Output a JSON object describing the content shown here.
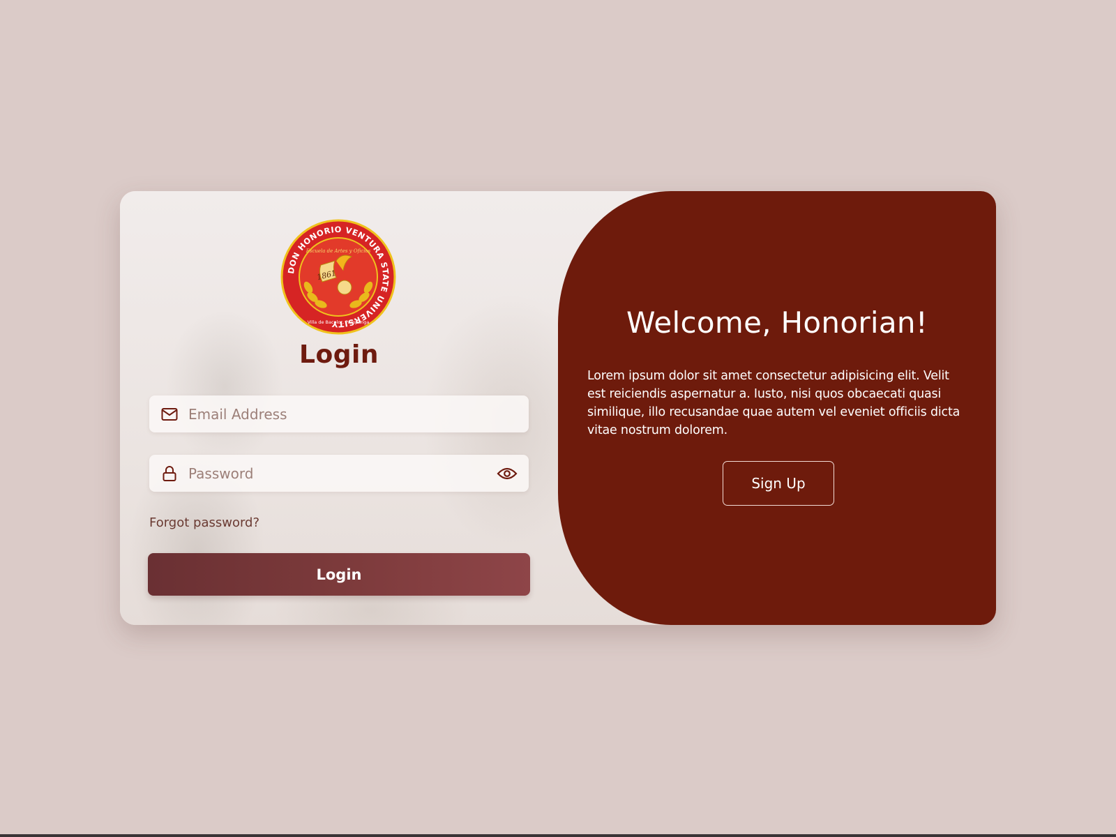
{
  "colors": {
    "background": "#dbcbc8",
    "brand_maroon": "#6e1b0c",
    "login_button": "#7c3a3b",
    "seal_red": "#d62424",
    "seal_gold": "#f0c21d"
  },
  "logo": {
    "name": "Don Honorio Ventura State University seal",
    "ring_text": "DON HONORIO VENTURA STATE UNIVERSITY",
    "script_text": "Escuela de Artes y Oficios",
    "year": "1861",
    "location": "Villa de Bacolor, Pampanga"
  },
  "login": {
    "title": "Login",
    "email": {
      "placeholder": "Email Address",
      "value": "",
      "icon": "mail-icon"
    },
    "password": {
      "placeholder": "Password",
      "value": "",
      "icon": "lock-icon",
      "toggle_icon": "eye-icon"
    },
    "forgot_label": "Forgot password?",
    "submit_label": "Login"
  },
  "welcome": {
    "title": "Welcome, Honorian!",
    "text": "Lorem ipsum dolor sit amet consectetur adipisicing elit. Velit est reiciendis aspernatur a. Iusto, nisi quos obcaecati quasi similique, illo recusandae quae autem vel eveniet officiis dicta vitae nostrum dolorem.",
    "signup_label": "Sign Up"
  }
}
